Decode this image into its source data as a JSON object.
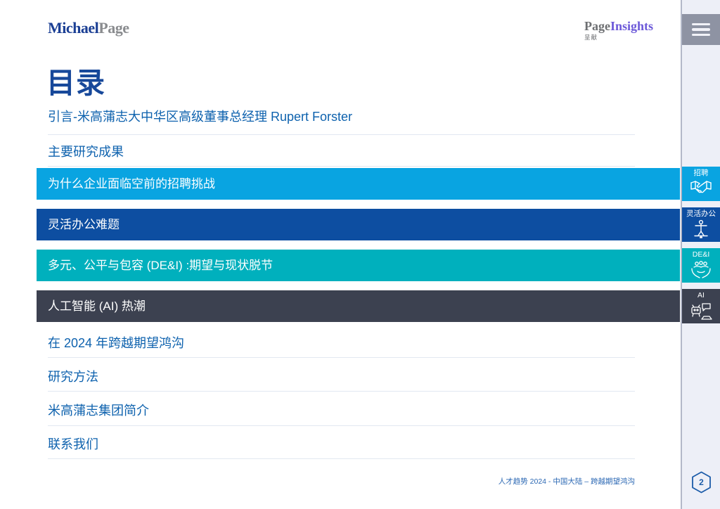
{
  "header": {
    "logo": {
      "part1": "Michael",
      "part2": "Page"
    },
    "insights": {
      "part1": "Page",
      "part2": "Insights",
      "subtitle": "呈献"
    }
  },
  "title": "目录",
  "toc": {
    "items": [
      {
        "label": "引言-米高蒲志大中华区高级董事总经理 Rupert Forster",
        "type": "link"
      },
      {
        "label": "主要研究成果",
        "type": "link"
      },
      {
        "label": "为什么企业面临空前的招聘挑战",
        "type": "section",
        "color": "#09A4E1"
      },
      {
        "label": "灵活办公难题",
        "type": "section",
        "color": "#0D4EA1"
      },
      {
        "label": "多元、公平与包容 (DE&I) :期望与现状脱节",
        "type": "section",
        "color": "#00B0BD"
      },
      {
        "label": "人工智能 (AI) 热潮",
        "type": "section",
        "color": "#3C4150"
      },
      {
        "label": "在 2024 年跨越期望鸿沟",
        "type": "link"
      },
      {
        "label": "研究方法",
        "type": "link"
      },
      {
        "label": "米高蒲志集团简介",
        "type": "link"
      },
      {
        "label": "联系我们",
        "type": "link"
      }
    ]
  },
  "sidebar": {
    "tabs": [
      {
        "label": "招聘",
        "icon": "handshake-icon",
        "color": "#09A4E1"
      },
      {
        "label": "灵活办公",
        "icon": "balance-person-icon",
        "color": "#0D4EA1"
      },
      {
        "label": "DE&I",
        "icon": "people-hands-icon",
        "color": "#00B0BD"
      },
      {
        "label": "AI",
        "icon": "ai-robot-icon",
        "color": "#3C4150"
      }
    ],
    "page_number": "2"
  },
  "footer": {
    "text": "人才趋势 2024 - 中国大陆 – 跨越期望鸿沟"
  },
  "colors": {
    "logo-navy": "#1B3F94",
    "logo-gray": "#8A8C8F",
    "insights-gray": "#6D6F72",
    "insights-purple": "#6C59D9",
    "title-navy": "#17489A",
    "link-blue": "#0E62AE",
    "divider": "#E2E8F1",
    "sidebar-bg": "#EDEFF7",
    "sidebar-border": "#B3B8C9",
    "hamburger-gray": "#8E93A3",
    "footer-blue": "#2A67B3",
    "hex-blue": "#1C5CA9"
  }
}
